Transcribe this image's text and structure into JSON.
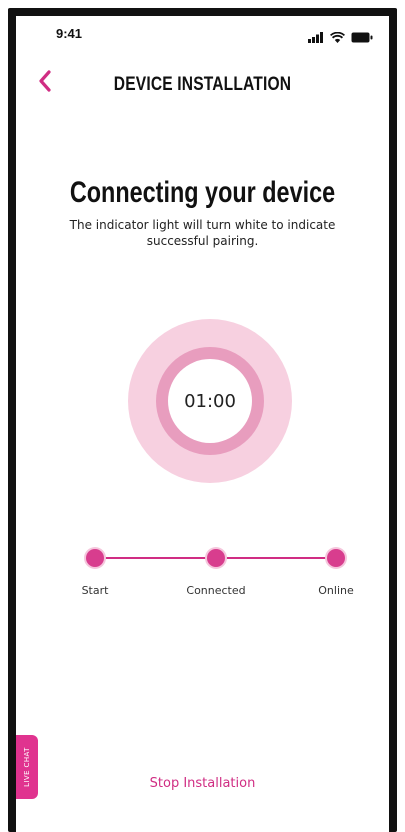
{
  "status_bar": {
    "time": "9:41",
    "icons": [
      "signal-icon",
      "wifi-icon",
      "battery-icon"
    ]
  },
  "header": {
    "back_icon": "chevron-left-icon",
    "title": "DEVICE INSTALLATION"
  },
  "main": {
    "heading": "Connecting your device",
    "subtext": "The indicator light will turn white to indicate successful pairing.",
    "timer": "01:00"
  },
  "steps": [
    {
      "label": "Start"
    },
    {
      "label": "Connected"
    },
    {
      "label": "Online"
    }
  ],
  "footer": {
    "live_chat_label": "LIVE CHAT",
    "stop_label": "Stop Installation"
  },
  "colors": {
    "accent": "#d02d83",
    "ring_outer": "#f7d0e0",
    "ring_mid": "#e89dbe",
    "live_chat_bg": "#e0338f"
  }
}
